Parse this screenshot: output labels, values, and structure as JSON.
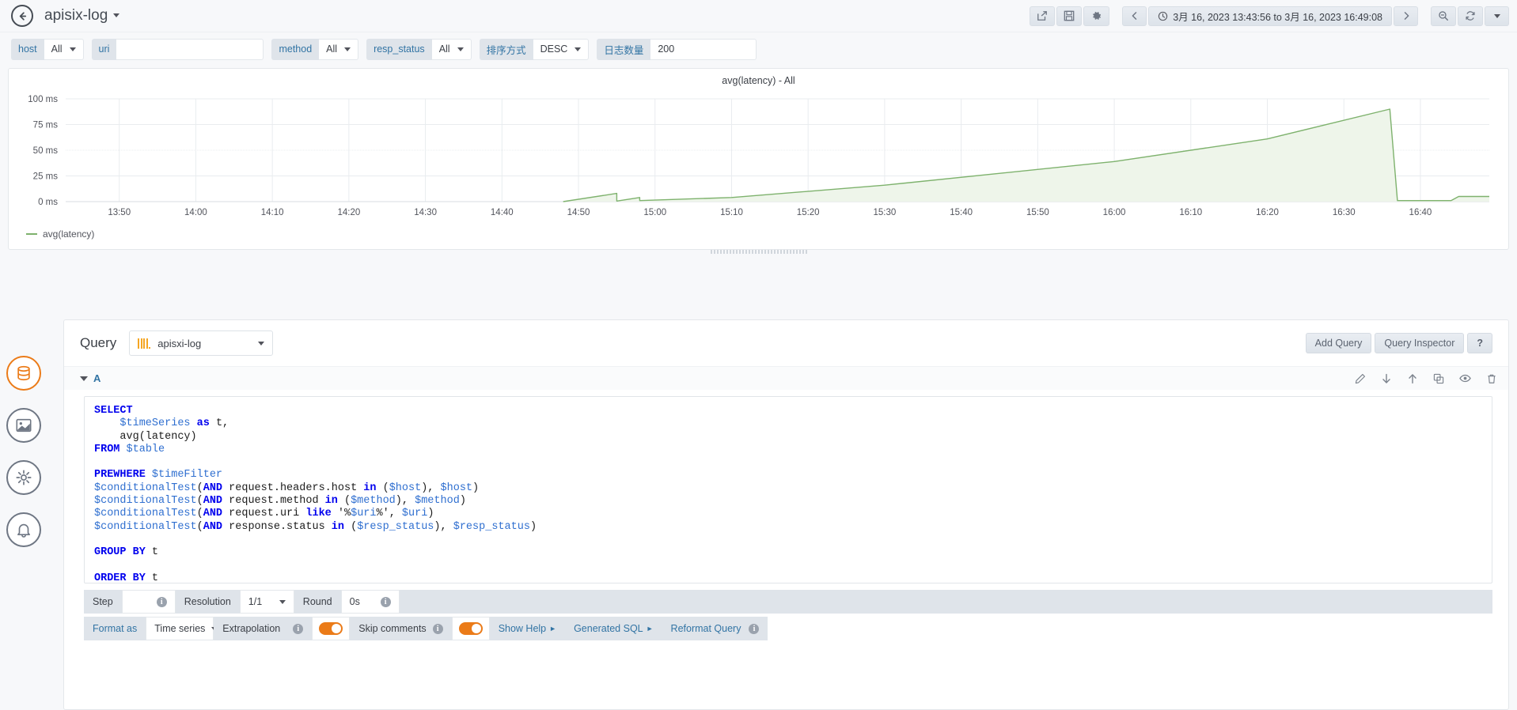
{
  "topnav": {
    "back_icon": "arrow-left-icon",
    "dashboard_title": "apisix-log",
    "buttons": [
      {
        "name": "share-dashboard-button",
        "icon": "share-icon"
      },
      {
        "name": "save-dashboard-button",
        "icon": "save-icon"
      },
      {
        "name": "dashboard-settings-button",
        "icon": "gear-icon"
      }
    ],
    "time_prev_icon": "chevron-left-icon",
    "time_range": "3月 16, 2023 13:43:56 to 3月 16, 2023 16:49:08",
    "time_clock_icon": "clock-icon",
    "time_next_icon": "chevron-right-icon",
    "zoom_out_icon": "magnifier-minus-icon",
    "refresh_icon": "refresh-icon",
    "refresh_interval_icon": "chevron-down-icon"
  },
  "variables": [
    {
      "name": "host",
      "label": "host",
      "value": "All",
      "type": "select"
    },
    {
      "name": "uri",
      "label": "uri",
      "value": "",
      "type": "text"
    },
    {
      "name": "method",
      "label": "method",
      "value": "All",
      "type": "select"
    },
    {
      "name": "resp_status",
      "label": "resp_status",
      "value": "All",
      "type": "select"
    },
    {
      "name": "sort_order",
      "label": "排序方式",
      "value": "DESC",
      "type": "select"
    },
    {
      "name": "log_count",
      "label": "日志数量",
      "value": "200",
      "type": "text"
    }
  ],
  "panel": {
    "title": "avg(latency) - All",
    "legend": "avg(latency)",
    "series_color": "#7eb26d"
  },
  "chart_data": {
    "type": "area",
    "title": "avg(latency) - All",
    "xlabel": "",
    "ylabel": "",
    "unit": "ms",
    "ylim": [
      0,
      100
    ],
    "yticks": [
      "0 ms",
      "25 ms",
      "50 ms",
      "75 ms",
      "100 ms"
    ],
    "ytick_values": [
      0,
      25,
      50,
      75,
      100
    ],
    "xticks": [
      "13:50",
      "14:00",
      "14:10",
      "14:20",
      "14:30",
      "14:40",
      "14:50",
      "15:00",
      "15:10",
      "15:20",
      "15:30",
      "15:40",
      "15:50",
      "16:00",
      "16:10",
      "16:20",
      "16:30",
      "16:40"
    ],
    "grid": true,
    "legend_position": "bottom-left",
    "series": [
      {
        "name": "avg(latency)",
        "color": "#7eb26d",
        "fill_color": "#eef5ea",
        "points": [
          {
            "x": "14:48",
            "y": 0
          },
          {
            "x": "14:55",
            "y": 8
          },
          {
            "x": "14:55",
            "y": 0.5
          },
          {
            "x": "14:58",
            "y": 4
          },
          {
            "x": "14:58",
            "y": 1
          },
          {
            "x": "15:10",
            "y": 4
          },
          {
            "x": "15:30",
            "y": 16
          },
          {
            "x": "16:00",
            "y": 39
          },
          {
            "x": "16:20",
            "y": 61
          },
          {
            "x": "16:36",
            "y": 90
          },
          {
            "x": "16:37",
            "y": 1
          },
          {
            "x": "16:44",
            "y": 1
          },
          {
            "x": "16:45",
            "y": 5
          },
          {
            "x": "16:49",
            "y": 5
          }
        ]
      }
    ]
  },
  "rail": [
    {
      "name": "queries-tab-icon",
      "icon": "database-icon",
      "active": true
    },
    {
      "name": "visualization-tab-icon",
      "icon": "graph-icon",
      "active": false
    },
    {
      "name": "general-tab-icon",
      "icon": "sliders-icon",
      "active": false
    },
    {
      "name": "alert-tab-icon",
      "icon": "bell-icon",
      "active": false
    }
  ],
  "editor": {
    "query_label": "Query",
    "datasource": "apisxi-log",
    "datasource_icon": "clickhouse-icon",
    "add_query_label": "Add Query",
    "query_inspector_label": "Query Inspector",
    "help_label": "?",
    "query_row": {
      "letter": "A",
      "actions": [
        {
          "name": "edit-query-button",
          "icon": "pencil-icon"
        },
        {
          "name": "move-query-down-button",
          "icon": "arrow-down-icon"
        },
        {
          "name": "move-query-up-button",
          "icon": "arrow-up-icon"
        },
        {
          "name": "duplicate-query-button",
          "icon": "copy-icon"
        },
        {
          "name": "toggle-query-visibility-button",
          "icon": "eye-icon"
        },
        {
          "name": "remove-query-button",
          "icon": "trash-icon"
        }
      ]
    },
    "sql": "SELECT\n    $timeSeries as t,\n    avg(latency)\nFROM $table\n\nPREWHERE $timeFilter\n$conditionalTest(AND request.headers.host in ($host), $host)\n$conditionalTest(AND request.method in ($method), $method)\n$conditionalTest(AND request.uri like '%$uri%', $uri)\n$conditionalTest(AND response.status in ($resp_status), $resp_status)\n\nGROUP BY t\n\nORDER BY t",
    "options": {
      "step_label": "Step",
      "step_value": "",
      "resolution_label": "Resolution",
      "resolution_value": "1/1",
      "round_label": "Round",
      "round_value": "0s",
      "format_as_label": "Format as",
      "format_as_value": "Time series",
      "extrapolation_label": "Extrapolation",
      "extrapolation_on": true,
      "skip_comments_label": "Skip comments",
      "skip_comments_on": true,
      "show_help_label": "Show Help",
      "generated_sql_label": "Generated SQL",
      "reformat_query_label": "Reformat Query"
    }
  }
}
